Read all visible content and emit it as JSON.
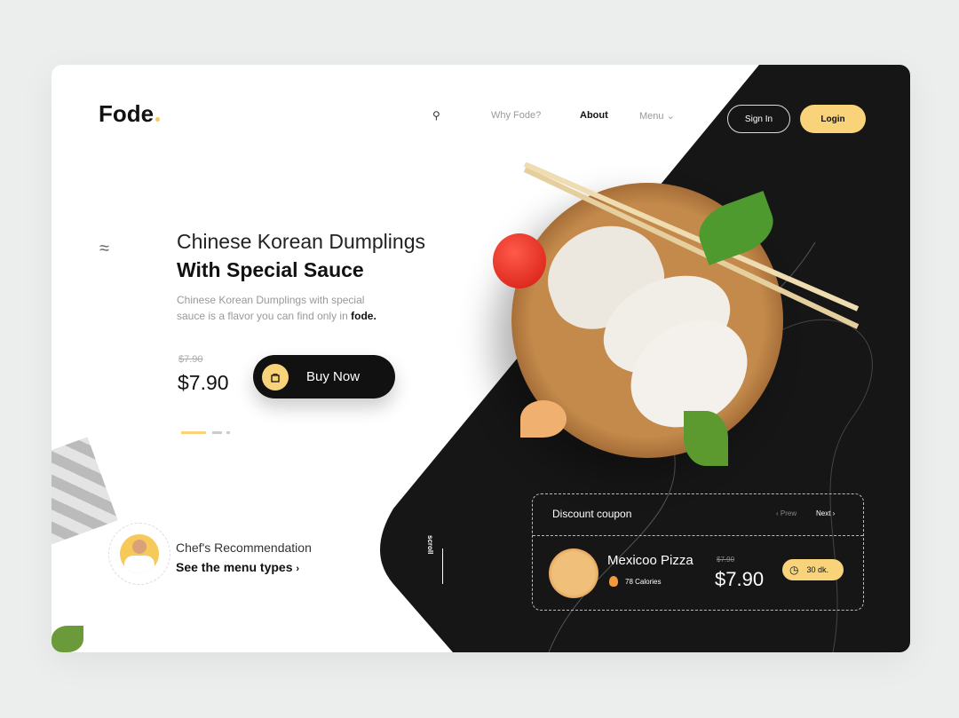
{
  "brand": {
    "name": "Fode"
  },
  "nav": {
    "items": [
      "Why Fode?",
      "About",
      "Menu"
    ],
    "active": "About",
    "sign_in": "Sign In",
    "login": "Login"
  },
  "hero": {
    "title_line1": "Chinese Korean Dumplings",
    "title_line2": "With Special Sauce",
    "description": "Chinese Korean Dumplings with special sauce is a flavor you can find only in",
    "description_brand": "fode.",
    "old_price": "$7.90",
    "price": "$7.90",
    "buy_label": "Buy Now"
  },
  "chef": {
    "title": "Chef's Recommendation",
    "link": "See the menu types"
  },
  "scroll": {
    "label": "scroll"
  },
  "coupon": {
    "title": "Discount coupon",
    "prev": "Prew",
    "next": "Next",
    "item": {
      "name": "Mexicoo Pizza",
      "calories": "78 Calories",
      "old_price": "$7.90",
      "price": "$7.90",
      "time": "30 dk."
    }
  },
  "colors": {
    "accent": "#f8d37a",
    "dark": "#161616"
  }
}
